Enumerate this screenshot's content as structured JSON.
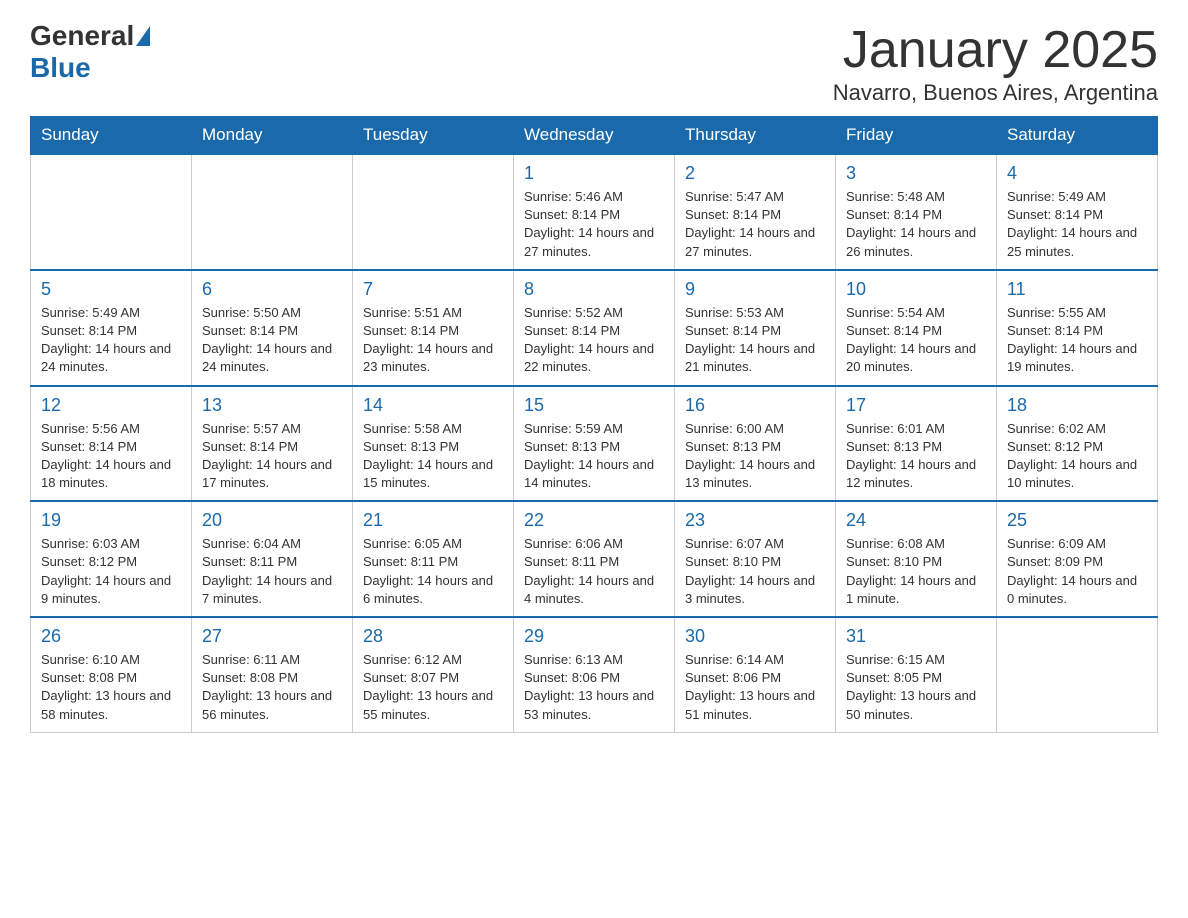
{
  "header": {
    "logo_general": "General",
    "logo_blue": "Blue",
    "title": "January 2025",
    "location": "Navarro, Buenos Aires, Argentina"
  },
  "days_of_week": [
    "Sunday",
    "Monday",
    "Tuesday",
    "Wednesday",
    "Thursday",
    "Friday",
    "Saturday"
  ],
  "weeks": [
    {
      "days": [
        {
          "num": "",
          "info": ""
        },
        {
          "num": "",
          "info": ""
        },
        {
          "num": "",
          "info": ""
        },
        {
          "num": "1",
          "info": "Sunrise: 5:46 AM\nSunset: 8:14 PM\nDaylight: 14 hours and 27 minutes."
        },
        {
          "num": "2",
          "info": "Sunrise: 5:47 AM\nSunset: 8:14 PM\nDaylight: 14 hours and 27 minutes."
        },
        {
          "num": "3",
          "info": "Sunrise: 5:48 AM\nSunset: 8:14 PM\nDaylight: 14 hours and 26 minutes."
        },
        {
          "num": "4",
          "info": "Sunrise: 5:49 AM\nSunset: 8:14 PM\nDaylight: 14 hours and 25 minutes."
        }
      ]
    },
    {
      "days": [
        {
          "num": "5",
          "info": "Sunrise: 5:49 AM\nSunset: 8:14 PM\nDaylight: 14 hours and 24 minutes."
        },
        {
          "num": "6",
          "info": "Sunrise: 5:50 AM\nSunset: 8:14 PM\nDaylight: 14 hours and 24 minutes."
        },
        {
          "num": "7",
          "info": "Sunrise: 5:51 AM\nSunset: 8:14 PM\nDaylight: 14 hours and 23 minutes."
        },
        {
          "num": "8",
          "info": "Sunrise: 5:52 AM\nSunset: 8:14 PM\nDaylight: 14 hours and 22 minutes."
        },
        {
          "num": "9",
          "info": "Sunrise: 5:53 AM\nSunset: 8:14 PM\nDaylight: 14 hours and 21 minutes."
        },
        {
          "num": "10",
          "info": "Sunrise: 5:54 AM\nSunset: 8:14 PM\nDaylight: 14 hours and 20 minutes."
        },
        {
          "num": "11",
          "info": "Sunrise: 5:55 AM\nSunset: 8:14 PM\nDaylight: 14 hours and 19 minutes."
        }
      ]
    },
    {
      "days": [
        {
          "num": "12",
          "info": "Sunrise: 5:56 AM\nSunset: 8:14 PM\nDaylight: 14 hours and 18 minutes."
        },
        {
          "num": "13",
          "info": "Sunrise: 5:57 AM\nSunset: 8:14 PM\nDaylight: 14 hours and 17 minutes."
        },
        {
          "num": "14",
          "info": "Sunrise: 5:58 AM\nSunset: 8:13 PM\nDaylight: 14 hours and 15 minutes."
        },
        {
          "num": "15",
          "info": "Sunrise: 5:59 AM\nSunset: 8:13 PM\nDaylight: 14 hours and 14 minutes."
        },
        {
          "num": "16",
          "info": "Sunrise: 6:00 AM\nSunset: 8:13 PM\nDaylight: 14 hours and 13 minutes."
        },
        {
          "num": "17",
          "info": "Sunrise: 6:01 AM\nSunset: 8:13 PM\nDaylight: 14 hours and 12 minutes."
        },
        {
          "num": "18",
          "info": "Sunrise: 6:02 AM\nSunset: 8:12 PM\nDaylight: 14 hours and 10 minutes."
        }
      ]
    },
    {
      "days": [
        {
          "num": "19",
          "info": "Sunrise: 6:03 AM\nSunset: 8:12 PM\nDaylight: 14 hours and 9 minutes."
        },
        {
          "num": "20",
          "info": "Sunrise: 6:04 AM\nSunset: 8:11 PM\nDaylight: 14 hours and 7 minutes."
        },
        {
          "num": "21",
          "info": "Sunrise: 6:05 AM\nSunset: 8:11 PM\nDaylight: 14 hours and 6 minutes."
        },
        {
          "num": "22",
          "info": "Sunrise: 6:06 AM\nSunset: 8:11 PM\nDaylight: 14 hours and 4 minutes."
        },
        {
          "num": "23",
          "info": "Sunrise: 6:07 AM\nSunset: 8:10 PM\nDaylight: 14 hours and 3 minutes."
        },
        {
          "num": "24",
          "info": "Sunrise: 6:08 AM\nSunset: 8:10 PM\nDaylight: 14 hours and 1 minute."
        },
        {
          "num": "25",
          "info": "Sunrise: 6:09 AM\nSunset: 8:09 PM\nDaylight: 14 hours and 0 minutes."
        }
      ]
    },
    {
      "days": [
        {
          "num": "26",
          "info": "Sunrise: 6:10 AM\nSunset: 8:08 PM\nDaylight: 13 hours and 58 minutes."
        },
        {
          "num": "27",
          "info": "Sunrise: 6:11 AM\nSunset: 8:08 PM\nDaylight: 13 hours and 56 minutes."
        },
        {
          "num": "28",
          "info": "Sunrise: 6:12 AM\nSunset: 8:07 PM\nDaylight: 13 hours and 55 minutes."
        },
        {
          "num": "29",
          "info": "Sunrise: 6:13 AM\nSunset: 8:06 PM\nDaylight: 13 hours and 53 minutes."
        },
        {
          "num": "30",
          "info": "Sunrise: 6:14 AM\nSunset: 8:06 PM\nDaylight: 13 hours and 51 minutes."
        },
        {
          "num": "31",
          "info": "Sunrise: 6:15 AM\nSunset: 8:05 PM\nDaylight: 13 hours and 50 minutes."
        },
        {
          "num": "",
          "info": ""
        }
      ]
    }
  ]
}
